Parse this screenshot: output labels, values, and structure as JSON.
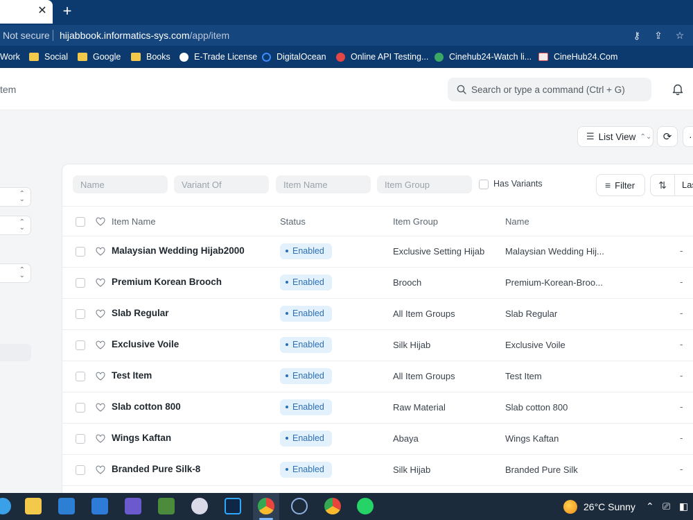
{
  "browser": {
    "tab_close": "✕",
    "new_tab": "+",
    "security_label": "Not secure",
    "url_host": "hijabbook.informatics-sys.com",
    "url_path": "/app/item",
    "bookmarks": [
      {
        "label": "Work",
        "icon": "folder-icon"
      },
      {
        "label": "Social",
        "icon": "folder-icon"
      },
      {
        "label": "Google",
        "icon": "folder-icon"
      },
      {
        "label": "Books",
        "icon": "folder-icon"
      },
      {
        "label": "E-Trade License",
        "icon": "globe-icon"
      },
      {
        "label": "DigitalOcean",
        "icon": "digitalocean-icon"
      },
      {
        "label": "Online API Testing...",
        "icon": "api-icon"
      },
      {
        "label": "Cinehub24-Watch li...",
        "icon": "cinehub-icon"
      },
      {
        "label": "CineHub24.Com",
        "icon": "cinehub-icon"
      }
    ]
  },
  "header": {
    "breadcrumb": "tem",
    "search_placeholder": "Search or type a command (Ctrl + G)"
  },
  "toolbar": {
    "list_view_label": "List View",
    "more_label": "···"
  },
  "filters": {
    "name_placeholder": "Name",
    "variant_of_placeholder": "Variant Of",
    "item_name_placeholder": "Item Name",
    "item_group_placeholder": "Item Group",
    "has_variants_label": "Has Variants",
    "filter_label": "Filter",
    "sort_label": "Las"
  },
  "table": {
    "columns": {
      "item_name": "Item Name",
      "status": "Status",
      "item_group": "Item Group",
      "name": "Name"
    },
    "rows": [
      {
        "item_name": "Malaysian Wedding Hijab2000",
        "status": "Enabled",
        "item_group": "Exclusive Setting Hijab",
        "name": "Malaysian Wedding Hij...",
        "extra": "-"
      },
      {
        "item_name": "Premium Korean Brooch",
        "status": "Enabled",
        "item_group": "Brooch",
        "name": "Premium-Korean-Broo...",
        "extra": "-"
      },
      {
        "item_name": "Slab Regular",
        "status": "Enabled",
        "item_group": "All Item Groups",
        "name": "Slab Regular",
        "extra": "-"
      },
      {
        "item_name": "Exclusive Voile",
        "status": "Enabled",
        "item_group": "Silk Hijab",
        "name": "Exclusive Voile",
        "extra": "-"
      },
      {
        "item_name": "Test Item",
        "status": "Enabled",
        "item_group": "All Item Groups",
        "name": "Test Item",
        "extra": "-"
      },
      {
        "item_name": "Slab cotton 800",
        "status": "Enabled",
        "item_group": "Raw Material",
        "name": "Slab cotton 800",
        "extra": "-"
      },
      {
        "item_name": "Wings Kaftan",
        "status": "Enabled",
        "item_group": "Abaya",
        "name": "Wings Kaftan",
        "extra": "-"
      },
      {
        "item_name": "Branded Pure Silk-8",
        "status": "Enabled",
        "item_group": "Silk Hijab",
        "name": "Branded Pure Silk",
        "extra": "-"
      }
    ]
  },
  "taskbar": {
    "weather": "26°C  Sunny"
  },
  "colors": {
    "browser_chrome": "#0d3a6e",
    "status_badge_bg": "#e3f1fd",
    "status_badge_text": "#2b6fb6",
    "taskbar": "#1c2b3c"
  }
}
